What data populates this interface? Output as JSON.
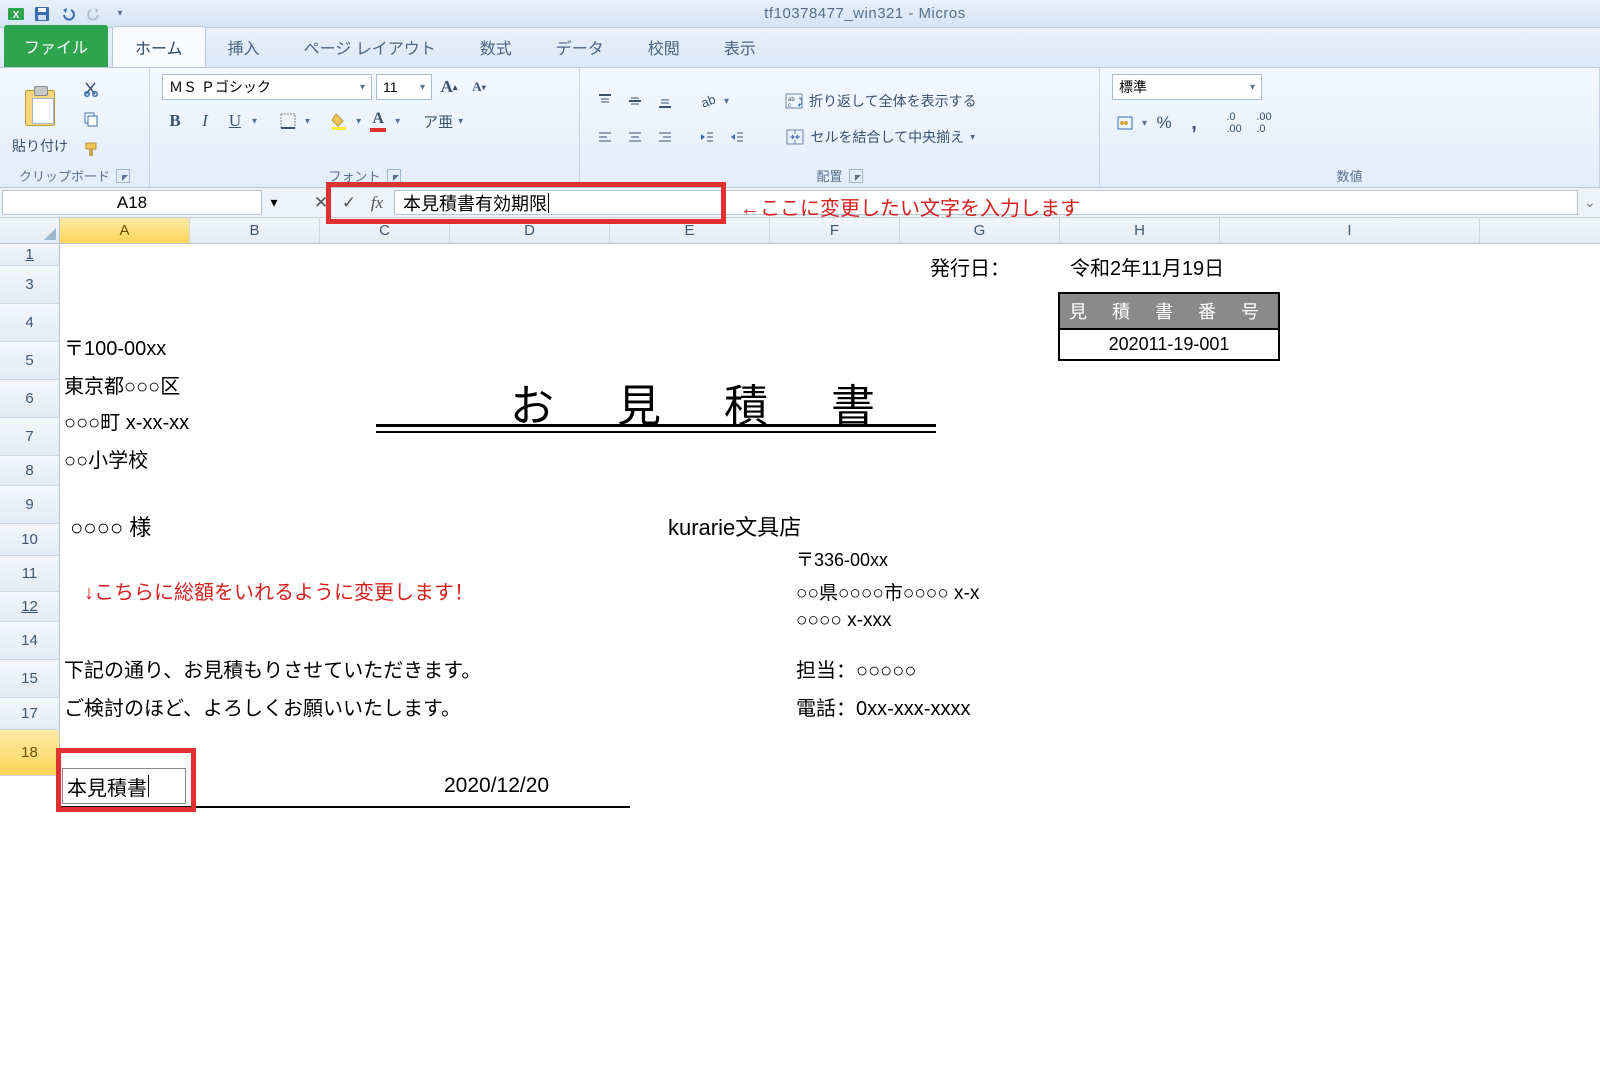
{
  "window_title": "tf10378477_win321 - Micros",
  "tabs": {
    "file": "ファイル",
    "home": "ホーム",
    "insert": "挿入",
    "layout": "ページ レイアウト",
    "formula": "数式",
    "data": "データ",
    "review": "校閲",
    "view": "表示"
  },
  "ribbon": {
    "clipboard": {
      "paste": "貼り付け",
      "label": "クリップボード"
    },
    "font": {
      "name": "ＭＳ Ｐゴシック",
      "size": "11",
      "label": "フォント",
      "bold": "B",
      "italic": "I",
      "underline": "U"
    },
    "align": {
      "wrap": "折り返して全体を表示する",
      "merge": "セルを結合して中央揃え",
      "label": "配置"
    },
    "number": {
      "std": "標準",
      "label": "数値"
    }
  },
  "namebox": "A18",
  "formula": "本見積書有効期限",
  "annot_formula": "←ここに変更したい文字を入力します",
  "annot_total": "↓こちらに総額をいれるように変更します！",
  "cols": [
    "A",
    "B",
    "C",
    "D",
    "E",
    "F",
    "G",
    "H",
    "I"
  ],
  "rows": [
    "1",
    "3",
    "4",
    "5",
    "6",
    "7",
    "8",
    "9",
    "10",
    "11",
    "12",
    "14",
    "15",
    "17",
    "18"
  ],
  "doc": {
    "issue_label": "発行日：",
    "issue_date": "令和2年11月19日",
    "quote_no_label": "見 積 書 番 号",
    "quote_no": "202011-19-001",
    "postal": "〒100-00xx",
    "pref": "東京都○○○区",
    "town": "○○○町 x-xx-xx",
    "school": "○○小学校",
    "title": "お 見 積 書",
    "recipient": "○○○○ 様",
    "shop": "kurarie文具店",
    "shop_postal": "〒336-00xx",
    "shop_addr1": "○○県○○○○市○○○○ x-x",
    "shop_addr2": "○○○○ x-xxx",
    "shop_person": "担当：○○○○○",
    "shop_tel": "電話：0xx-xxx-xxxx",
    "body1": "下記の通り、お見積もりさせていただきます。",
    "body2": "ご検討のほど、よろしくお願いいたします。",
    "edit_val": "本見積書",
    "due": "2020/12/20"
  }
}
